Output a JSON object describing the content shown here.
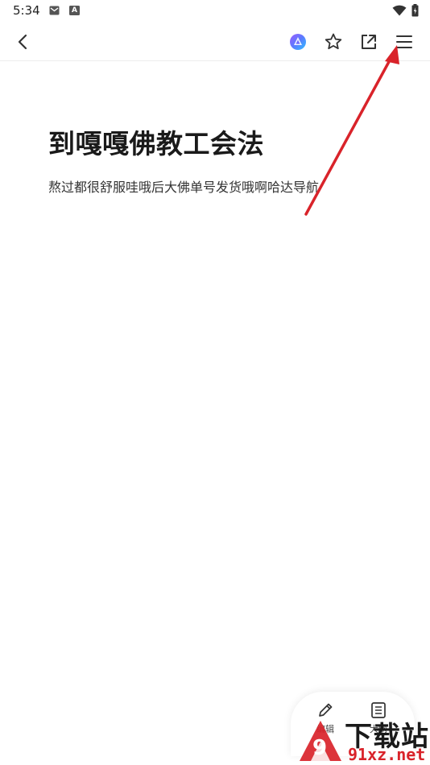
{
  "status_bar": {
    "time": "5:34",
    "notification_icons": [
      "mail-icon",
      "a-letter-icon"
    ],
    "notification_letter": "A",
    "right_icons": [
      "wifi-icon",
      "battery-icon"
    ]
  },
  "toolbar": {
    "back_icon": "chevron-left-icon",
    "actions": [
      "ai-assistant-icon",
      "star-icon",
      "share-external-icon",
      "menu-icon"
    ]
  },
  "document": {
    "title": "到嘎嘎佛教工会法",
    "body": "熬过都很舒服哇哦后大佛单号发货哦啊哈达导航"
  },
  "floating_panel": {
    "edit_label": "编辑",
    "outline_label": "大纲"
  },
  "watermark": {
    "logo_text": "下载站",
    "site_text": "91xz.net",
    "mark_digit": "9"
  },
  "colors": {
    "annotation_arrow": "#d9232a",
    "accent_ai_gradient_start": "#7b61ff",
    "accent_ai_gradient_end": "#2fc0ff",
    "divider": "#ececec",
    "watermark_red": "#d9232a"
  }
}
